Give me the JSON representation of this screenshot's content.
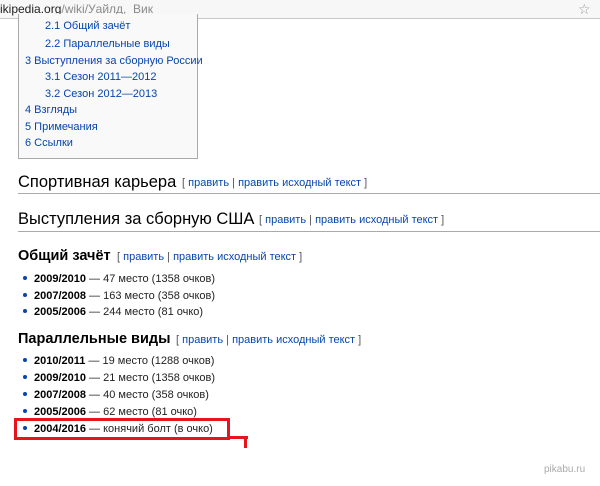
{
  "browser": {
    "url_host": "ikipedia.org",
    "url_path": "/wiki/Уайлд,_Вик"
  },
  "toc": {
    "items": [
      "2.1 Общий зачёт",
      "2.2 Параллельные виды",
      "3 Выступления за сборную России",
      "3.1 Сезон 2011—2012",
      "3.2 Сезон 2012—2013",
      "4 Взгляды",
      "5 Примечания",
      "6 Ссылки"
    ]
  },
  "edit_links": {
    "edit": "править",
    "edit_source": "править исходный текст",
    "open_bracket": "[",
    "close_bracket": "]",
    "separator": "|"
  },
  "sections": {
    "career": "Спортивная карьера",
    "usa": "Выступления за сборную США",
    "overall": "Общий зачёт",
    "parallel": "Параллельные виды"
  },
  "overall_results": [
    {
      "season": "2009/2010",
      "text": " — 47 место (1358 очков)"
    },
    {
      "season": "2007/2008",
      "text": " — 163 место (358 очков)"
    },
    {
      "season": "2005/2006",
      "text": " — 244 место (81 очко)"
    }
  ],
  "parallel_results": [
    {
      "season": "2010/2011",
      "text": " — 19 место (1288 очков)"
    },
    {
      "season": "2009/2010",
      "text": " — 21 место (1358 очков)"
    },
    {
      "season": "2007/2008",
      "text": " — 40 место (358 очков)"
    },
    {
      "season": "2005/2006",
      "text": " — 62 место (81 очко)"
    },
    {
      "season": "2004/2016",
      "text": " — конячий болт (в очко)"
    }
  ],
  "watermark": "pikabu.ru",
  "colors": {
    "link": "#0645ad",
    "highlight": "#e8141b"
  },
  "icons": {
    "bookmark": "star-icon"
  }
}
